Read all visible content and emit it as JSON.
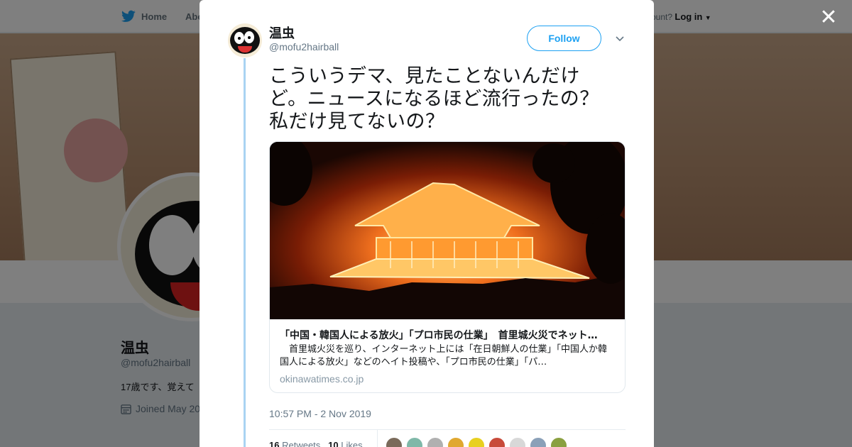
{
  "topnav": {
    "home_label": "Home",
    "about_label": "Abo",
    "account_prompt": "ccount?",
    "login_label": "Log in"
  },
  "profile": {
    "name": "温虫",
    "handle": "@mofu2hairball",
    "bio": "17歳です、覚えて",
    "joined": "Joined May 20"
  },
  "tweet": {
    "author_name": "温虫",
    "author_handle": "@mofu2hairball",
    "follow_label": "Follow",
    "text": "こういうデマ、見たことないんだけど。ニュースになるほど流行ったの？私だけ見てないの？",
    "card": {
      "title": "「中国・韓国人による放火」「プロ市民の仕業」　首里城火災でネット…",
      "description": "　首里城火災を巡り、インターネット上には「在日朝鮮人の仕業」「中国人か韓国人による放火」などのヘイト投稿や、「プロ市民の仕業」「パ…",
      "domain": "okinawatimes.co.jp"
    },
    "timestamp": "10:57 PM - 2 Nov 2019",
    "retweets_count": "16",
    "retweets_label": "Retweets",
    "likes_count": "10",
    "likes_label": "Likes"
  },
  "colors": {
    "accent": "#1da1f2",
    "thread_line": "#a9d3f2",
    "muted_text": "#657786"
  },
  "icons": [
    "twitter-bird-icon",
    "close-icon",
    "chevron-down-icon",
    "calendar-icon",
    "dropdown-caret-icon"
  ]
}
